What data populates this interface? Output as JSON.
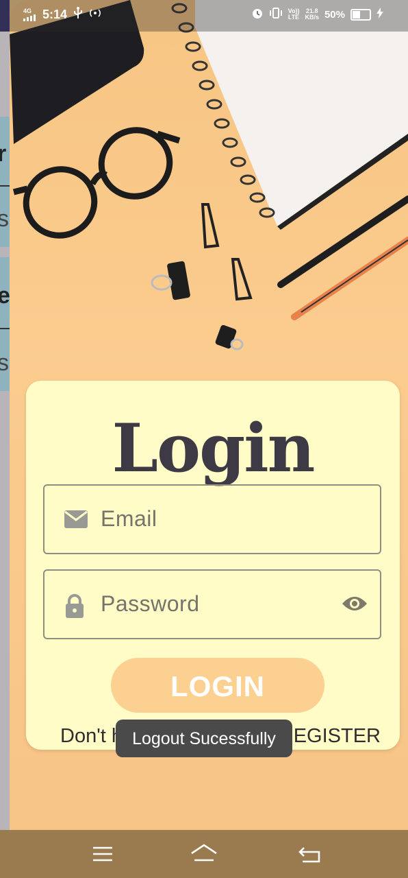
{
  "status_bar": {
    "network": "4G",
    "time": "5:14",
    "volte": "Vo))",
    "lte": "LTE",
    "speed_value": "21.8",
    "speed_unit": "KB/s",
    "battery": "50%"
  },
  "behind_screen": {
    "glyph_top": "r",
    "glyph_s1": "s",
    "glyph_mid": "e",
    "glyph_s2": "s"
  },
  "login": {
    "title": "Login",
    "email_placeholder": "Email",
    "password_placeholder": "Password",
    "login_button": "LOGIN",
    "register_prompt": "Don't h",
    "register_link": "REGISTER"
  },
  "toast": {
    "message": "Logout Sucessfully"
  },
  "colors": {
    "background": "#f7c98a",
    "card": "#fffcc8",
    "title": "#3d3a46",
    "button": "#fbd090",
    "nav": "#9a7b4f"
  },
  "icons": {
    "email": "mail-icon",
    "password": "lock-icon",
    "visibility": "eye-icon",
    "nav_menu": "menu-icon",
    "nav_home": "home-icon",
    "nav_back": "back-icon"
  }
}
